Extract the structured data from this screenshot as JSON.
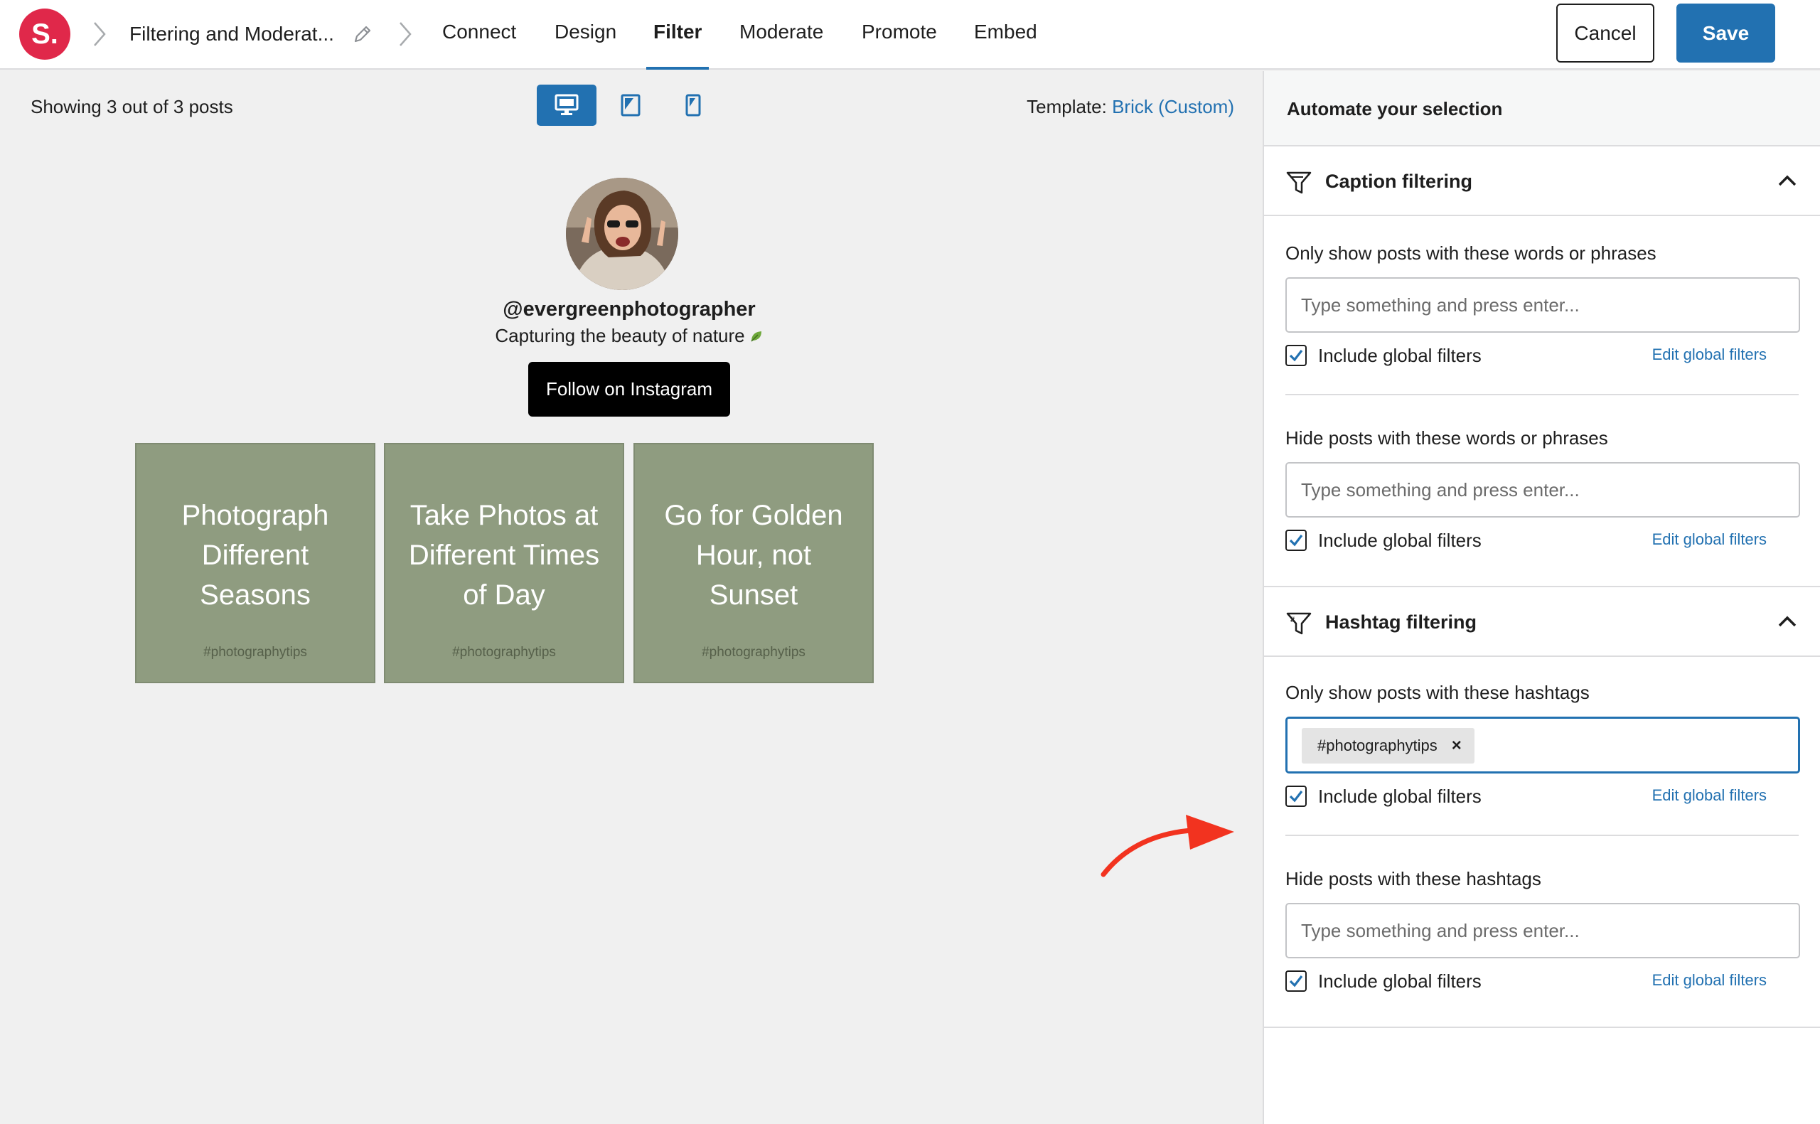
{
  "app": {
    "logo_text": "S."
  },
  "breadcrumb": {
    "title": "Filtering and Moderat..."
  },
  "nav": {
    "tabs": [
      {
        "label": "Connect"
      },
      {
        "label": "Design"
      },
      {
        "label": "Filter",
        "active": true
      },
      {
        "label": "Moderate"
      },
      {
        "label": "Promote"
      },
      {
        "label": "Embed"
      }
    ]
  },
  "actions": {
    "cancel_label": "Cancel",
    "save_label": "Save"
  },
  "preview": {
    "showing_text": "Showing 3 out of 3 posts",
    "devices": [
      "desktop-icon",
      "tablet-icon",
      "mobile-icon"
    ],
    "active_device": "desktop",
    "template_label": "Template:",
    "template_value": "Brick (Custom)",
    "profile": {
      "username": "@evergreenphotographer",
      "bio": "Capturing the beauty of nature",
      "follow_label": "Follow on Instagram"
    },
    "posts": [
      {
        "title": "Photograph Different Seasons",
        "tag": "#photographytips"
      },
      {
        "title": "Take Photos at Different Times of Day",
        "tag": "#photographytips"
      },
      {
        "title": "Go for Golden Hour, not Sunset",
        "tag": "#photographytips"
      }
    ]
  },
  "sidebar": {
    "heading": "Automate your selection",
    "caption": {
      "title": "Caption filtering",
      "show_label": "Only show posts with these words or phrases",
      "show_placeholder": "Type something and press enter...",
      "hide_label": "Hide posts with these words or phrases",
      "hide_placeholder": "Type something and press enter...",
      "include_global_label": "Include global filters",
      "edit_global_label": "Edit global filters"
    },
    "hashtag": {
      "title": "Hashtag filtering",
      "show_label": "Only show posts with these hashtags",
      "show_tags": [
        "#photographytips"
      ],
      "hide_label": "Hide posts with these hashtags",
      "hide_placeholder": "Type something and press enter...",
      "include_global_label": "Include global filters",
      "edit_global_label": "Edit global filters"
    }
  },
  "colors": {
    "accent": "#2271b1",
    "brand": "#e0284a",
    "post_bg": "#8f9c80",
    "arrow": "#f2331f"
  }
}
